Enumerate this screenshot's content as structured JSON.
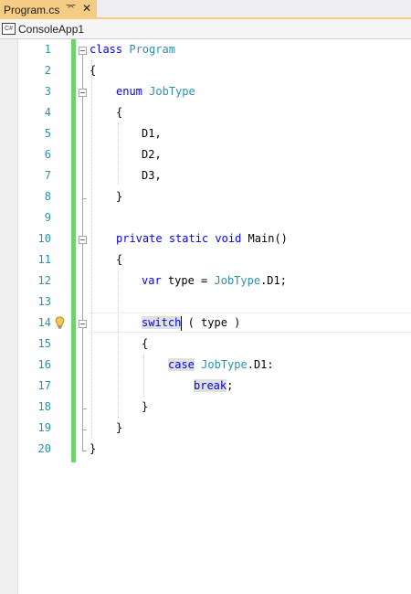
{
  "tab": {
    "title": "Program.cs",
    "pin_icon": "pin-icon",
    "close_icon": "close-icon"
  },
  "navbar": {
    "project": "ConsoleApp1",
    "project_icon_text": "C#"
  },
  "editor": {
    "line_numbers": [
      "1",
      "2",
      "3",
      "4",
      "5",
      "6",
      "7",
      "8",
      "9",
      "10",
      "11",
      "12",
      "13",
      "14",
      "15",
      "16",
      "17",
      "18",
      "19",
      "20"
    ],
    "lines": [
      {
        "kw1": "class",
        "ty1": "Program"
      },
      {
        "text": "{"
      },
      {
        "kw1": "enum",
        "ty1": "JobType"
      },
      {
        "text": "{"
      },
      {
        "text": "D1,"
      },
      {
        "text": "D2,"
      },
      {
        "text": "D3,"
      },
      {
        "text": "}"
      },
      {
        "text": ""
      },
      {
        "kw1": "private",
        "kw2": "static",
        "kw3": "void",
        "name": "Main()"
      },
      {
        "text": "{"
      },
      {
        "kw1": "var",
        "mid": "type = ",
        "ty1": "JobType",
        "rest": ".D1;"
      },
      {
        "text": ""
      },
      {
        "kw1a": "switch",
        "kw1b": "",
        "rest": " ( type )"
      },
      {
        "text": "{"
      },
      {
        "kw1": "case",
        "ty1": "JobType",
        "rest": ".D1:"
      },
      {
        "kw1": "break",
        "rest": ";"
      },
      {
        "text": "}"
      },
      {
        "text": "}"
      },
      {
        "text": "}"
      }
    ]
  }
}
